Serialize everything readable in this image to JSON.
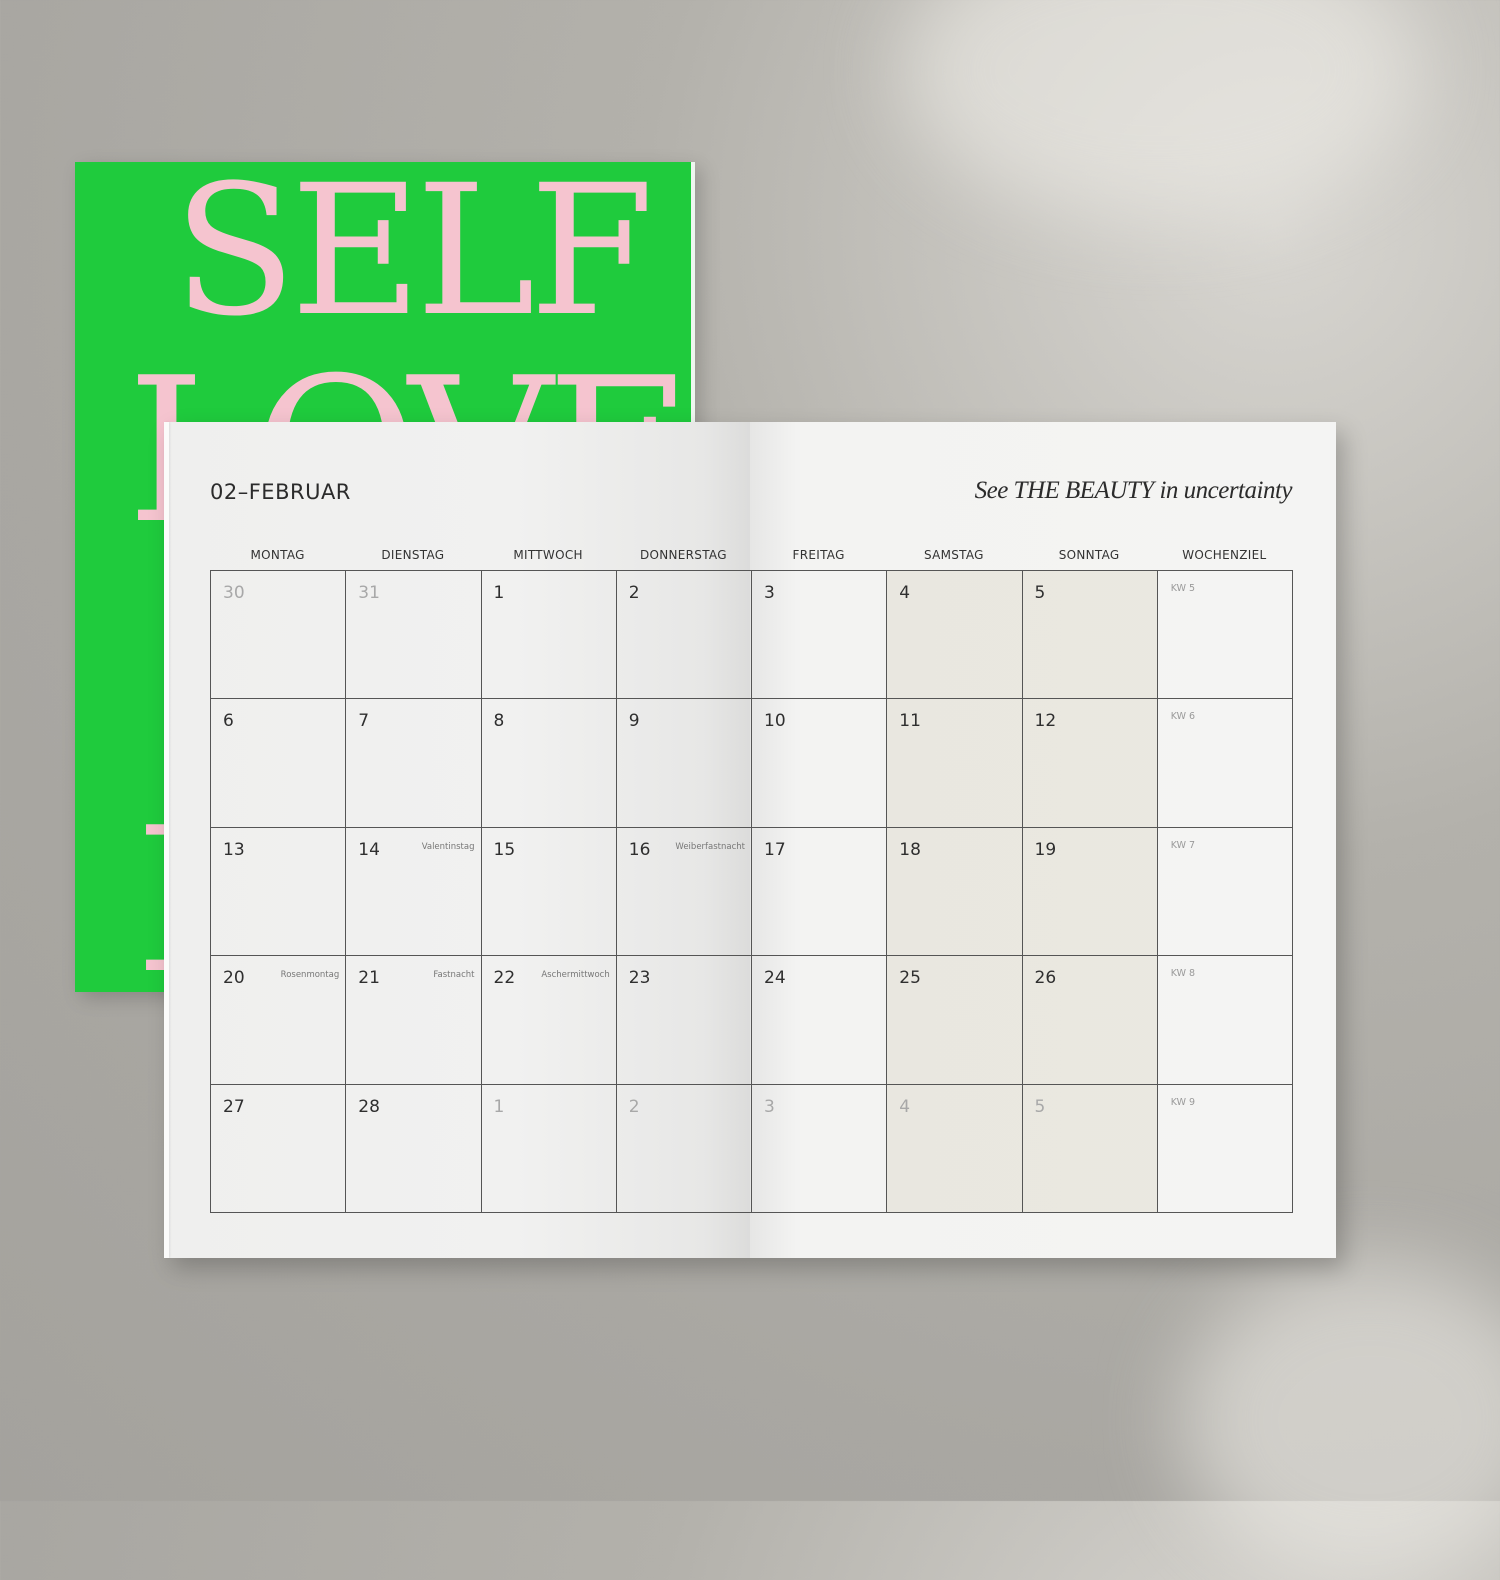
{
  "cover": {
    "line1": "SELF",
    "line2": "LOVE",
    "line3": "I"
  },
  "planner": {
    "month_title": "02–FEBRUAR",
    "tagline": "See THE BEAUTY in uncertainty",
    "day_headers": [
      "MONTAG",
      "DIENSTAG",
      "MITTWOCH",
      "DONNERSTAG",
      "FREITAG",
      "SAMSTAG",
      "SONNTAG",
      "WOCHENZIEL"
    ],
    "weeks": [
      {
        "kw": "KW 5",
        "days": [
          {
            "num": "30",
            "muted": true,
            "note": ""
          },
          {
            "num": "31",
            "muted": true,
            "note": ""
          },
          {
            "num": "1",
            "muted": false,
            "note": ""
          },
          {
            "num": "2",
            "muted": false,
            "note": ""
          },
          {
            "num": "3",
            "muted": false,
            "note": ""
          },
          {
            "num": "4",
            "muted": false,
            "note": ""
          },
          {
            "num": "5",
            "muted": false,
            "note": ""
          }
        ]
      },
      {
        "kw": "KW 6",
        "days": [
          {
            "num": "6",
            "muted": false,
            "note": ""
          },
          {
            "num": "7",
            "muted": false,
            "note": ""
          },
          {
            "num": "8",
            "muted": false,
            "note": ""
          },
          {
            "num": "9",
            "muted": false,
            "note": ""
          },
          {
            "num": "10",
            "muted": false,
            "note": ""
          },
          {
            "num": "11",
            "muted": false,
            "note": ""
          },
          {
            "num": "12",
            "muted": false,
            "note": ""
          }
        ]
      },
      {
        "kw": "KW 7",
        "days": [
          {
            "num": "13",
            "muted": false,
            "note": ""
          },
          {
            "num": "14",
            "muted": false,
            "note": "Valentinstag"
          },
          {
            "num": "15",
            "muted": false,
            "note": ""
          },
          {
            "num": "16",
            "muted": false,
            "note": "Weiberfastnacht"
          },
          {
            "num": "17",
            "muted": false,
            "note": ""
          },
          {
            "num": "18",
            "muted": false,
            "note": ""
          },
          {
            "num": "19",
            "muted": false,
            "note": ""
          }
        ]
      },
      {
        "kw": "KW 8",
        "days": [
          {
            "num": "20",
            "muted": false,
            "note": "Rosenmontag"
          },
          {
            "num": "21",
            "muted": false,
            "note": "Fastnacht"
          },
          {
            "num": "22",
            "muted": false,
            "note": "Aschermittwoch"
          },
          {
            "num": "23",
            "muted": false,
            "note": ""
          },
          {
            "num": "24",
            "muted": false,
            "note": ""
          },
          {
            "num": "25",
            "muted": false,
            "note": ""
          },
          {
            "num": "26",
            "muted": false,
            "note": ""
          }
        ]
      },
      {
        "kw": "KW 9",
        "days": [
          {
            "num": "27",
            "muted": false,
            "note": ""
          },
          {
            "num": "28",
            "muted": false,
            "note": ""
          },
          {
            "num": "1",
            "muted": true,
            "note": ""
          },
          {
            "num": "2",
            "muted": true,
            "note": ""
          },
          {
            "num": "3",
            "muted": true,
            "note": ""
          },
          {
            "num": "4",
            "muted": true,
            "note": ""
          },
          {
            "num": "5",
            "muted": true,
            "note": ""
          }
        ]
      }
    ]
  },
  "colors": {
    "cover_green": "#1fcb3d",
    "cover_pink": "#f5c4cf",
    "paper": "#f4f3f1",
    "weekend_tint": "#e9e4da"
  }
}
